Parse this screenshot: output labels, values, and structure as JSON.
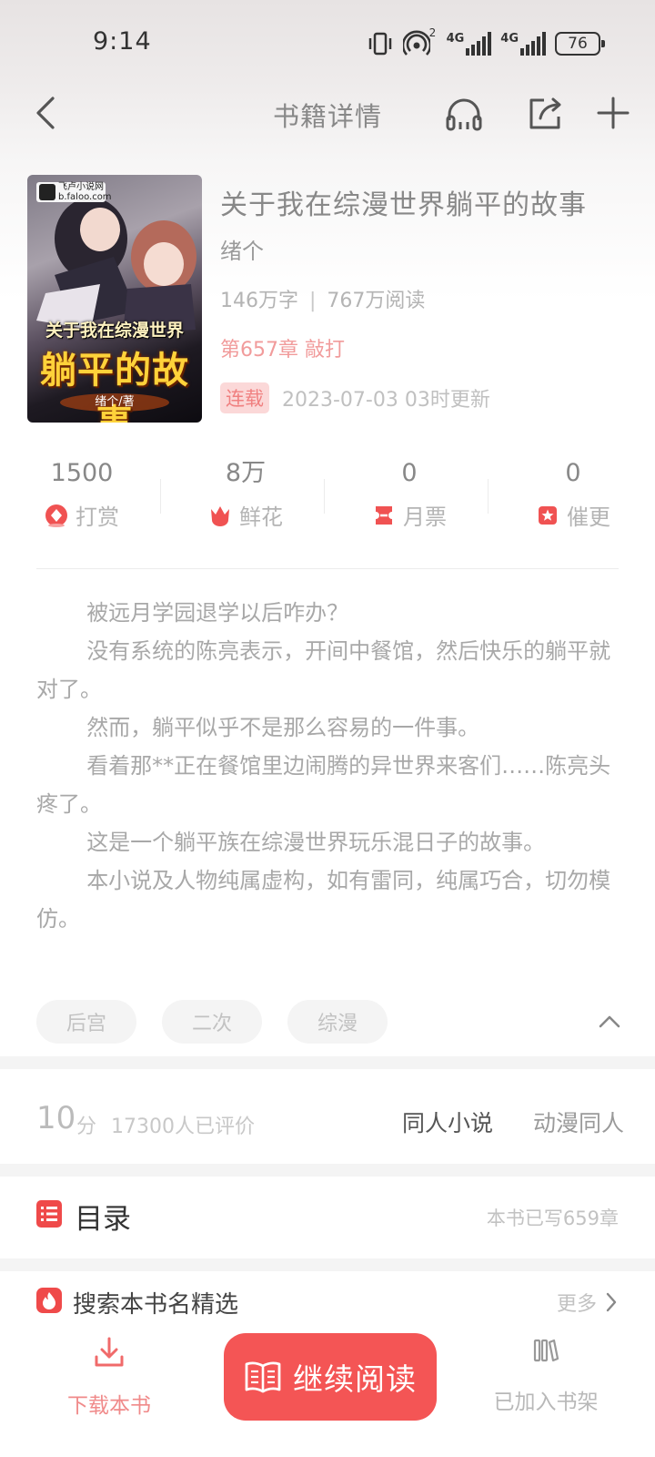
{
  "status_bar": {
    "time": "9:14",
    "network_1": "4G",
    "network_2": "4G",
    "hotspot_badge": "2",
    "battery": "76"
  },
  "nav": {
    "title": "书籍详情"
  },
  "book": {
    "title": "关于我在综漫世界躺平的故事",
    "author": "绪个",
    "word_count": "146万字",
    "read_count": "767万阅读",
    "latest_chapter": "第657章 敲打",
    "status_tag": "连载",
    "update_time": "2023-07-03 03时更新"
  },
  "cover": {
    "publisher_line1": "飞卢小说网",
    "publisher_line2": "b.faloo.com",
    "title_line1": "关于我在综漫世界",
    "title_line2": "躺平的故事",
    "author_line": "绪个/著"
  },
  "interactions": [
    {
      "value": "1500",
      "label": "打赏",
      "icon": "reward-icon"
    },
    {
      "value": "8万",
      "label": "鲜花",
      "icon": "flower-icon"
    },
    {
      "value": "0",
      "label": "月票",
      "icon": "ticket-icon"
    },
    {
      "value": "0",
      "label": "催更",
      "icon": "urge-icon"
    }
  ],
  "synopsis": {
    "p1": "被远月学园退学以后咋办？",
    "p2": "没有系统的陈亮表示，开间中餐馆，然后快乐的躺平就对了。",
    "p3": "然而，躺平似乎不是那么容易的一件事。",
    "p4": "看着那**正在餐馆里边闹腾的异世界来客们……陈亮头疼了。",
    "p5": "这是一个躺平族在综漫世界玩乐混日子的故事。",
    "p6": "本小说及人物纯属虚构，如有雷同，纯属巧合，切勿模仿。"
  },
  "tags": [
    "后宫",
    "二次",
    "综漫"
  ],
  "rating": {
    "score": "10",
    "unit": "分",
    "count": "17300人已评价",
    "category_1": "同人小说",
    "category_2": "动漫同人"
  },
  "catalog": {
    "title": "目录",
    "count": "本书已写659章"
  },
  "search_section": {
    "title": "搜索本书名精选",
    "more": "更多"
  },
  "bottom_bar": {
    "download": "下载本书",
    "read": "继续阅读",
    "shelf": "已加入书架"
  },
  "colors": {
    "accent": "#f45555",
    "tag_bg": "#fbd8d8",
    "latest_chapter": "#f19b9b"
  }
}
